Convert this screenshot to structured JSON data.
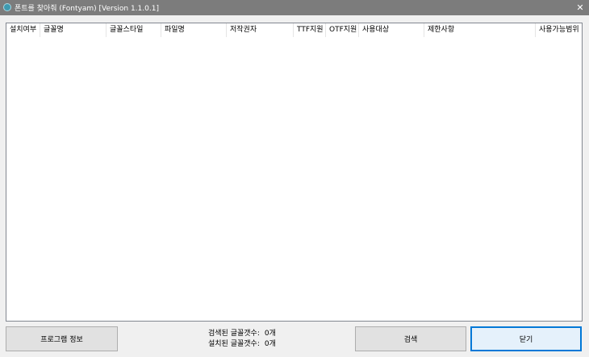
{
  "window": {
    "title": "폰트를 찾아줘 (Fontyam) [Version 1.1.0.1]",
    "close_glyph": "✕"
  },
  "list": {
    "columns": [
      "설치여부",
      "글꼴명",
      "글꼴스타일",
      "파일명",
      "저작권자",
      "TTF지원",
      "OTF지원",
      "사용대상",
      "제한사항",
      "사용가능범위"
    ],
    "rows": []
  },
  "status": {
    "searched_label": "검색된 글꼴갯수:",
    "searched_count": "0개",
    "installed_label": "설치된 글꼴갯수:",
    "installed_count": "0개"
  },
  "buttons": {
    "program_info": "프로그램 정보",
    "search": "검색",
    "close": "닫기"
  }
}
